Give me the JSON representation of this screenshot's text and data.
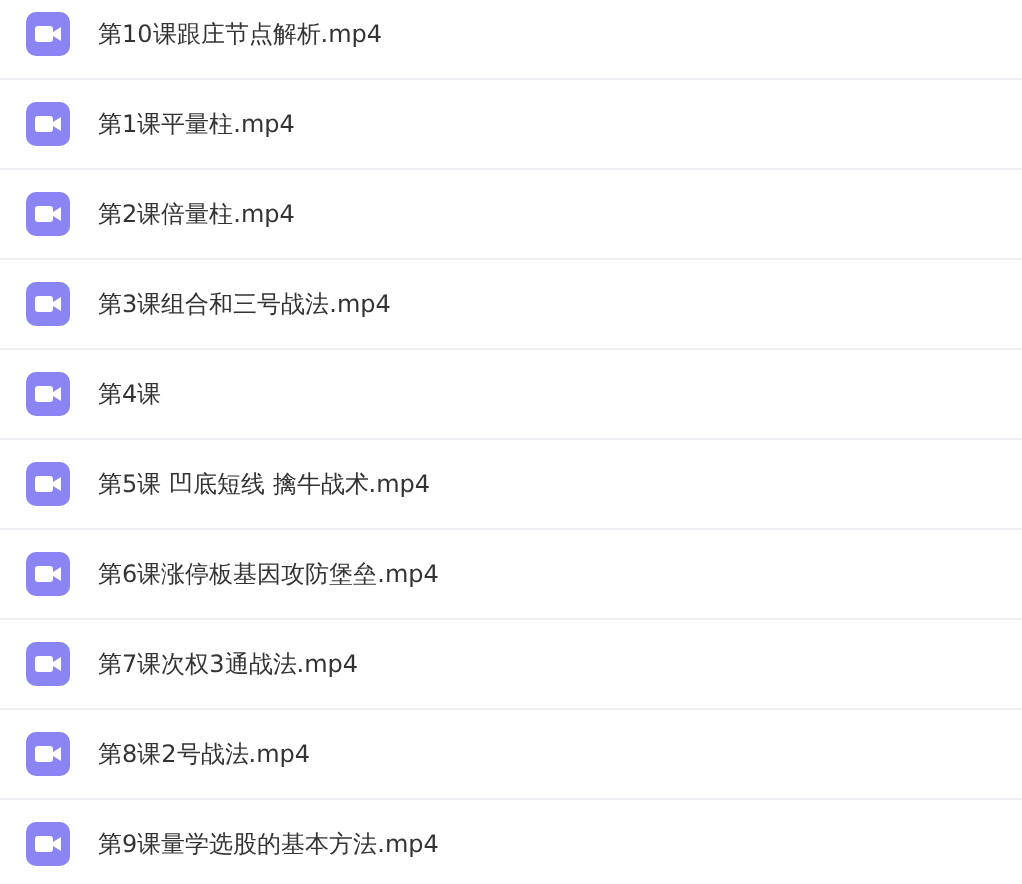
{
  "files": [
    {
      "name": "第10课跟庄节点解析.mp4"
    },
    {
      "name": "第1课平量柱.mp4"
    },
    {
      "name": "第2课倍量柱.mp4"
    },
    {
      "name": "第3课组合和三号战法.mp4"
    },
    {
      "name": "第4课"
    },
    {
      "name": "第5课 凹底短线 擒牛战术.mp4"
    },
    {
      "name": "第6课涨停板基因攻防堡垒.mp4"
    },
    {
      "name": "第7课次权3通战法.mp4"
    },
    {
      "name": "第8课2号战法.mp4"
    },
    {
      "name": "第9课量学选股的基本方法.mp4"
    }
  ]
}
